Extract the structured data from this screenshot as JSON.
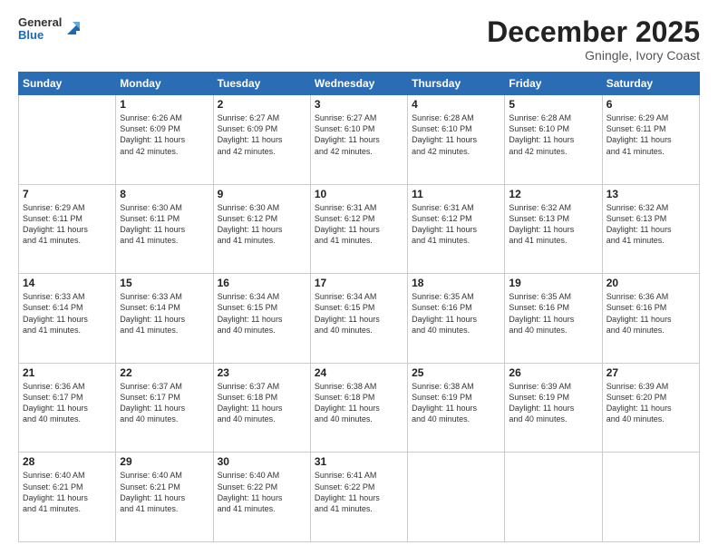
{
  "header": {
    "logo_general": "General",
    "logo_blue": "Blue",
    "title": "December 2025",
    "subtitle": "Gningle, Ivory Coast"
  },
  "weekdays": [
    "Sunday",
    "Monday",
    "Tuesday",
    "Wednesday",
    "Thursday",
    "Friday",
    "Saturday"
  ],
  "weeks": [
    [
      {
        "day": "",
        "info": ""
      },
      {
        "day": "1",
        "info": "Sunrise: 6:26 AM\nSunset: 6:09 PM\nDaylight: 11 hours\nand 42 minutes."
      },
      {
        "day": "2",
        "info": "Sunrise: 6:27 AM\nSunset: 6:09 PM\nDaylight: 11 hours\nand 42 minutes."
      },
      {
        "day": "3",
        "info": "Sunrise: 6:27 AM\nSunset: 6:10 PM\nDaylight: 11 hours\nand 42 minutes."
      },
      {
        "day": "4",
        "info": "Sunrise: 6:28 AM\nSunset: 6:10 PM\nDaylight: 11 hours\nand 42 minutes."
      },
      {
        "day": "5",
        "info": "Sunrise: 6:28 AM\nSunset: 6:10 PM\nDaylight: 11 hours\nand 42 minutes."
      },
      {
        "day": "6",
        "info": "Sunrise: 6:29 AM\nSunset: 6:11 PM\nDaylight: 11 hours\nand 41 minutes."
      }
    ],
    [
      {
        "day": "7",
        "info": "Sunrise: 6:29 AM\nSunset: 6:11 PM\nDaylight: 11 hours\nand 41 minutes."
      },
      {
        "day": "8",
        "info": "Sunrise: 6:30 AM\nSunset: 6:11 PM\nDaylight: 11 hours\nand 41 minutes."
      },
      {
        "day": "9",
        "info": "Sunrise: 6:30 AM\nSunset: 6:12 PM\nDaylight: 11 hours\nand 41 minutes."
      },
      {
        "day": "10",
        "info": "Sunrise: 6:31 AM\nSunset: 6:12 PM\nDaylight: 11 hours\nand 41 minutes."
      },
      {
        "day": "11",
        "info": "Sunrise: 6:31 AM\nSunset: 6:12 PM\nDaylight: 11 hours\nand 41 minutes."
      },
      {
        "day": "12",
        "info": "Sunrise: 6:32 AM\nSunset: 6:13 PM\nDaylight: 11 hours\nand 41 minutes."
      },
      {
        "day": "13",
        "info": "Sunrise: 6:32 AM\nSunset: 6:13 PM\nDaylight: 11 hours\nand 41 minutes."
      }
    ],
    [
      {
        "day": "14",
        "info": "Sunrise: 6:33 AM\nSunset: 6:14 PM\nDaylight: 11 hours\nand 41 minutes."
      },
      {
        "day": "15",
        "info": "Sunrise: 6:33 AM\nSunset: 6:14 PM\nDaylight: 11 hours\nand 41 minutes."
      },
      {
        "day": "16",
        "info": "Sunrise: 6:34 AM\nSunset: 6:15 PM\nDaylight: 11 hours\nand 40 minutes."
      },
      {
        "day": "17",
        "info": "Sunrise: 6:34 AM\nSunset: 6:15 PM\nDaylight: 11 hours\nand 40 minutes."
      },
      {
        "day": "18",
        "info": "Sunrise: 6:35 AM\nSunset: 6:16 PM\nDaylight: 11 hours\nand 40 minutes."
      },
      {
        "day": "19",
        "info": "Sunrise: 6:35 AM\nSunset: 6:16 PM\nDaylight: 11 hours\nand 40 minutes."
      },
      {
        "day": "20",
        "info": "Sunrise: 6:36 AM\nSunset: 6:16 PM\nDaylight: 11 hours\nand 40 minutes."
      }
    ],
    [
      {
        "day": "21",
        "info": "Sunrise: 6:36 AM\nSunset: 6:17 PM\nDaylight: 11 hours\nand 40 minutes."
      },
      {
        "day": "22",
        "info": "Sunrise: 6:37 AM\nSunset: 6:17 PM\nDaylight: 11 hours\nand 40 minutes."
      },
      {
        "day": "23",
        "info": "Sunrise: 6:37 AM\nSunset: 6:18 PM\nDaylight: 11 hours\nand 40 minutes."
      },
      {
        "day": "24",
        "info": "Sunrise: 6:38 AM\nSunset: 6:18 PM\nDaylight: 11 hours\nand 40 minutes."
      },
      {
        "day": "25",
        "info": "Sunrise: 6:38 AM\nSunset: 6:19 PM\nDaylight: 11 hours\nand 40 minutes."
      },
      {
        "day": "26",
        "info": "Sunrise: 6:39 AM\nSunset: 6:19 PM\nDaylight: 11 hours\nand 40 minutes."
      },
      {
        "day": "27",
        "info": "Sunrise: 6:39 AM\nSunset: 6:20 PM\nDaylight: 11 hours\nand 40 minutes."
      }
    ],
    [
      {
        "day": "28",
        "info": "Sunrise: 6:40 AM\nSunset: 6:21 PM\nDaylight: 11 hours\nand 41 minutes."
      },
      {
        "day": "29",
        "info": "Sunrise: 6:40 AM\nSunset: 6:21 PM\nDaylight: 11 hours\nand 41 minutes."
      },
      {
        "day": "30",
        "info": "Sunrise: 6:40 AM\nSunset: 6:22 PM\nDaylight: 11 hours\nand 41 minutes."
      },
      {
        "day": "31",
        "info": "Sunrise: 6:41 AM\nSunset: 6:22 PM\nDaylight: 11 hours\nand 41 minutes."
      },
      {
        "day": "",
        "info": ""
      },
      {
        "day": "",
        "info": ""
      },
      {
        "day": "",
        "info": ""
      }
    ]
  ]
}
